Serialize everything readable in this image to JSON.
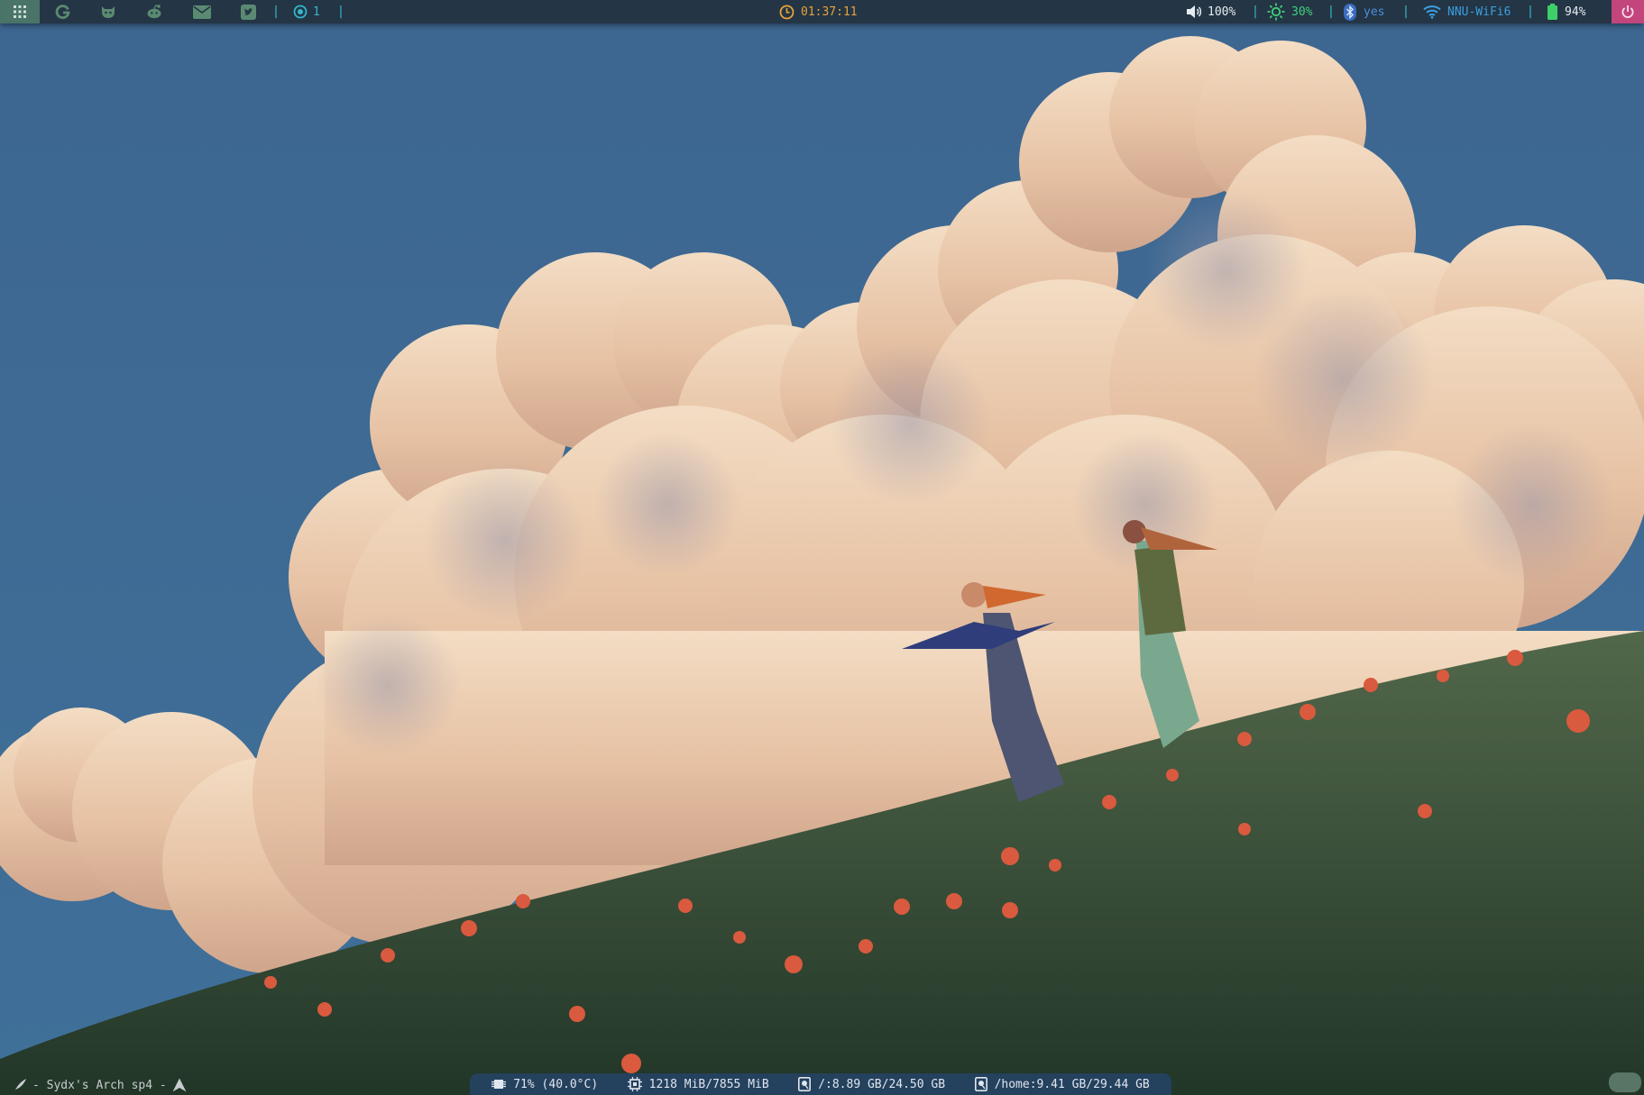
{
  "topbar": {
    "launcher_icon": "grid-icon",
    "apps": [
      {
        "name": "google",
        "icon": "google-icon"
      },
      {
        "name": "github",
        "icon": "github-icon"
      },
      {
        "name": "reddit",
        "icon": "reddit-icon"
      },
      {
        "name": "mail",
        "icon": "mail-icon"
      },
      {
        "name": "twitter",
        "icon": "twitter-icon"
      }
    ],
    "workspace": "1",
    "clock": "01:37:11",
    "volume": "100%",
    "brightness": "30%",
    "bluetooth": "yes",
    "wifi": "NNU-WiFi6",
    "battery": "94%"
  },
  "bottombar": {
    "host": "- Sydx's Arch sp4 -",
    "cpu": "71%  (40.0°C)",
    "memory": "1218 MiB/7855 MiB",
    "disk_root": "/:8.89 GB/24.50 GB",
    "disk_home": "/home:9.41 GB/29.44 GB"
  },
  "colors": {
    "bar_bg": "#243545",
    "accent_cyan": "#33b6c9",
    "clock": "#e9a23b",
    "volume": "#e6ecf0",
    "brightness": "#3fd17a",
    "bluetooth": "#4b8de0",
    "wifi": "#3b9fe0",
    "battery": "#3fcf6a",
    "launcher": "#4a7468",
    "power": "#c2457c",
    "stats_bg": "#24415e"
  }
}
